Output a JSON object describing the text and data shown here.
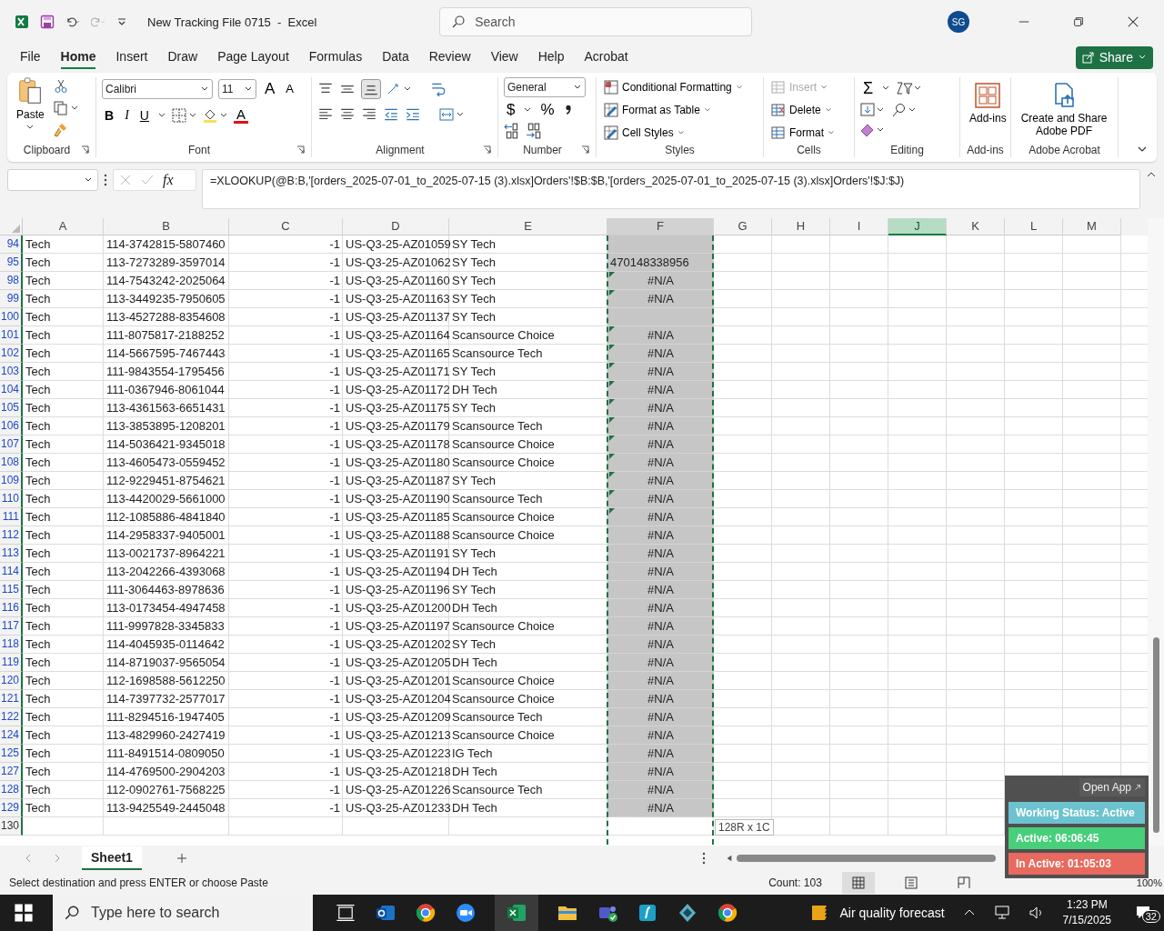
{
  "titlebar": {
    "title": "New Tracking File 0715  -  Excel",
    "search_placeholder": "Search",
    "avatar": "SG"
  },
  "menu_tabs": [
    {
      "label": "File",
      "selected": false
    },
    {
      "label": "Home",
      "selected": true
    },
    {
      "label": "Insert",
      "selected": false
    },
    {
      "label": "Draw",
      "selected": false
    },
    {
      "label": "Page Layout",
      "selected": false
    },
    {
      "label": "Formulas",
      "selected": false
    },
    {
      "label": "Data",
      "selected": false
    },
    {
      "label": "Review",
      "selected": false
    },
    {
      "label": "View",
      "selected": false
    },
    {
      "label": "Help",
      "selected": false
    },
    {
      "label": "Acrobat",
      "selected": false
    }
  ],
  "share_button": "Share",
  "ribbon": {
    "clipboard": {
      "paste": "Paste",
      "group": "Clipboard"
    },
    "font": {
      "name": "Calibri",
      "size": "11",
      "grow": "A",
      "shrink": "A",
      "bold": "B",
      "italic": "I",
      "underline": "U",
      "font_color": "A",
      "group": "Font"
    },
    "alignment": {
      "group": "Alignment"
    },
    "number": {
      "format": "General",
      "currency": "$",
      "percent": "%",
      "group": "Number"
    },
    "styles": {
      "items": [
        "Conditional Formatting",
        "Format as Table",
        "Cell Styles"
      ],
      "group": "Styles"
    },
    "cells": {
      "items": [
        {
          "label": "Insert",
          "disabled": true
        },
        {
          "label": "Delete",
          "disabled": false
        },
        {
          "label": "Format",
          "disabled": false
        }
      ],
      "group": "Cells"
    },
    "editing": {
      "sum": "Σ",
      "group": "Editing"
    },
    "addins": {
      "button": "Add-ins",
      "group": "Add-ins"
    },
    "acrobat": {
      "button": "Create and Share Adobe PDF",
      "group": "Adobe Acrobat"
    }
  },
  "formula_bar": {
    "fx": "fx",
    "formula": "=XLOOKUP(@B:B,'[orders_2025-07-01_to_2025-07-15 (3).xlsx]Orders'!$B:$B,'[orders_2025-07-01_to_2025-07-15 (3).xlsx]Orders'!$J:$J)"
  },
  "columns": [
    {
      "label": "A",
      "selected": false,
      "in_range": false
    },
    {
      "label": "B",
      "selected": false,
      "in_range": false
    },
    {
      "label": "C",
      "selected": false,
      "in_range": false
    },
    {
      "label": "D",
      "selected": false,
      "in_range": false
    },
    {
      "label": "E",
      "selected": false,
      "in_range": false
    },
    {
      "label": "F",
      "selected": false,
      "in_range": true
    },
    {
      "label": "G",
      "selected": false,
      "in_range": false
    },
    {
      "label": "H",
      "selected": false,
      "in_range": false
    },
    {
      "label": "I",
      "selected": false,
      "in_range": false
    },
    {
      "label": "J",
      "selected": true,
      "in_range": false
    },
    {
      "label": "K",
      "selected": false,
      "in_range": false
    },
    {
      "label": "L",
      "selected": false,
      "in_range": false
    },
    {
      "label": "M",
      "selected": false,
      "in_range": false
    }
  ],
  "rows": [
    {
      "num": "94",
      "cells": [
        "Tech",
        "114-3742815-5807460",
        "-1",
        "US-Q3-25-AZ01059",
        "SY Tech"
      ],
      "flagged": false
    },
    {
      "num": "95",
      "cells": [
        "Tech",
        "113-7273289-3597014",
        "-1",
        "US-Q3-25-AZ01062",
        "SY Tech"
      ],
      "f": "470148338956",
      "flagged": false
    },
    {
      "num": "98",
      "cells": [
        "Tech",
        "114-7543242-2025064",
        "-1",
        "US-Q3-25-AZ01160",
        "SY Tech"
      ],
      "f": "#N/A",
      "flagged": true
    },
    {
      "num": "99",
      "cells": [
        "Tech",
        "113-3449235-7950605",
        "-1",
        "US-Q3-25-AZ01163",
        "SY Tech"
      ],
      "f": "#N/A",
      "flagged": true
    },
    {
      "num": "100",
      "cells": [
        "Tech",
        "113-4527288-8354608",
        "-1",
        "US-Q3-25-AZ01137",
        "SY Tech"
      ],
      "flagged": false
    },
    {
      "num": "101",
      "cells": [
        "Tech",
        "111-8075817-2188252",
        "-1",
        "US-Q3-25-AZ01164",
        "Scansource Choice"
      ],
      "f": "#N/A",
      "flagged": true
    },
    {
      "num": "102",
      "cells": [
        "Tech",
        "114-5667595-7467443",
        "-1",
        "US-Q3-25-AZ01165",
        "Scansource Tech"
      ],
      "f": "#N/A",
      "flagged": true
    },
    {
      "num": "103",
      "cells": [
        "Tech",
        "111-9843554-1795456",
        "-1",
        "US-Q3-25-AZ01171",
        "SY Tech"
      ],
      "f": "#N/A",
      "flagged": true
    },
    {
      "num": "104",
      "cells": [
        "Tech",
        "111-0367946-8061044",
        "-1",
        "US-Q3-25-AZ01172",
        "DH Tech"
      ],
      "f": "#N/A",
      "flagged": true
    },
    {
      "num": "105",
      "cells": [
        "Tech",
        "113-4361563-6651431",
        "-1",
        "US-Q3-25-AZ01175",
        "SY Tech"
      ],
      "f": "#N/A",
      "flagged": true
    },
    {
      "num": "106",
      "cells": [
        "Tech",
        "113-3853895-1208201",
        "-1",
        "US-Q3-25-AZ01179",
        "Scansource Tech"
      ],
      "f": "#N/A",
      "flagged": true
    },
    {
      "num": "107",
      "cells": [
        "Tech",
        "114-5036421-9345018",
        "-1",
        "US-Q3-25-AZ01178",
        "Scansource Choice"
      ],
      "f": "#N/A",
      "flagged": true
    },
    {
      "num": "108",
      "cells": [
        "Tech",
        "113-4605473-0559452",
        "-1",
        "US-Q3-25-AZ01180",
        "Scansource Choice"
      ],
      "f": "#N/A",
      "flagged": true
    },
    {
      "num": "109",
      "cells": [
        "Tech",
        "112-9229451-8754621",
        "-1",
        "US-Q3-25-AZ01187",
        "SY Tech"
      ],
      "f": "#N/A",
      "flagged": true
    },
    {
      "num": "110",
      "cells": [
        "Tech",
        "113-4420029-5661000",
        "-1",
        "US-Q3-25-AZ01190",
        "Scansource Tech"
      ],
      "f": "#N/A",
      "flagged": true
    },
    {
      "num": "111",
      "cells": [
        "Tech",
        "112-1085886-4841840",
        "-1",
        "US-Q3-25-AZ01185",
        "Scansource Choice"
      ],
      "f": "#N/A",
      "flagged": true
    },
    {
      "num": "112",
      "cells": [
        "Tech",
        "114-2958337-9405001",
        "-1",
        "US-Q3-25-AZ01188",
        "Scansource Choice"
      ],
      "f": "#N/A",
      "flagged": false
    },
    {
      "num": "113",
      "cells": [
        "Tech",
        "113-0021737-8964221",
        "-1",
        "US-Q3-25-AZ01191",
        "SY Tech"
      ],
      "f": "#N/A",
      "flagged": false
    },
    {
      "num": "114",
      "cells": [
        "Tech",
        "113-2042266-4393068",
        "-1",
        "US-Q3-25-AZ01194",
        "DH Tech"
      ],
      "f": "#N/A",
      "flagged": false
    },
    {
      "num": "115",
      "cells": [
        "Tech",
        "111-3064463-8978636",
        "-1",
        "US-Q3-25-AZ01196",
        "SY Tech"
      ],
      "f": "#N/A",
      "flagged": false
    },
    {
      "num": "116",
      "cells": [
        "Tech",
        "113-0173454-4947458",
        "-1",
        "US-Q3-25-AZ01200",
        "DH Tech"
      ],
      "f": "#N/A",
      "flagged": false
    },
    {
      "num": "117",
      "cells": [
        "Tech",
        "111-9997828-3345833",
        "-1",
        "US-Q3-25-AZ01197",
        "Scansource Choice"
      ],
      "f": "#N/A",
      "flagged": false
    },
    {
      "num": "118",
      "cells": [
        "Tech",
        "114-4045935-0114642",
        "-1",
        "US-Q3-25-AZ01202",
        "SY Tech"
      ],
      "f": "#N/A",
      "flagged": false
    },
    {
      "num": "119",
      "cells": [
        "Tech",
        "114-8719037-9565054",
        "-1",
        "US-Q3-25-AZ01205",
        "DH Tech"
      ],
      "f": "#N/A",
      "flagged": false
    },
    {
      "num": "120",
      "cells": [
        "Tech",
        "112-1698588-5612250",
        "-1",
        "US-Q3-25-AZ01201",
        "Scansource Choice"
      ],
      "f": "#N/A",
      "flagged": false
    },
    {
      "num": "121",
      "cells": [
        "Tech",
        "114-7397732-2577017",
        "-1",
        "US-Q3-25-AZ01204",
        "Scansource Choice"
      ],
      "f": "#N/A",
      "flagged": false
    },
    {
      "num": "122",
      "cells": [
        "Tech",
        "111-8294516-1947405",
        "-1",
        "US-Q3-25-AZ01209",
        "Scansource Tech"
      ],
      "f": "#N/A",
      "flagged": false
    },
    {
      "num": "124",
      "cells": [
        "Tech",
        "113-4829960-2427419",
        "-1",
        "US-Q3-25-AZ01213",
        "Scansource Choice"
      ],
      "f": "#N/A",
      "flagged": false
    },
    {
      "num": "125",
      "cells": [
        "Tech",
        "111-8491514-0809050",
        "-1",
        "US-Q3-25-AZ01223",
        "IG Tech"
      ],
      "f": "#N/A",
      "flagged": false
    },
    {
      "num": "127",
      "cells": [
        "Tech",
        "114-4769500-2904203",
        "-1",
        "US-Q3-25-AZ01218",
        "DH Tech"
      ],
      "f": "#N/A",
      "flagged": false
    },
    {
      "num": "128",
      "cells": [
        "Tech",
        "112-0902761-7568225",
        "-1",
        "US-Q3-25-AZ01226",
        "Scansource Tech"
      ],
      "f": "#N/A",
      "flagged": false
    },
    {
      "num": "129",
      "cells": [
        "Tech",
        "113-9425549-2445048",
        "-1",
        "US-Q3-25-AZ01233",
        "DH Tech"
      ],
      "f": "#N/A",
      "flagged": false
    }
  ],
  "empty_rows": [
    "130"
  ],
  "selection_tooltip": "128R x 1C",
  "sheet_tabs": [
    {
      "label": "Sheet1",
      "selected": true
    }
  ],
  "status_bar": {
    "message": "Select destination and press ENTER or choose Paste",
    "count": "Count: 103",
    "zoom": "100%"
  },
  "tracker_widget": {
    "open_app": "Open App",
    "lines": [
      {
        "text": "Working Status: Active",
        "color": "#6cc3cf"
      },
      {
        "text": "Active: 06:06:45",
        "color": "#47cf7a"
      },
      {
        "text": "In Active: 01:05:03",
        "color": "#e86a5e"
      }
    ]
  },
  "taskbar": {
    "search_placeholder": "Type here to search",
    "weather": "Air quality forecast",
    "time": "1:23 PM",
    "date": "7/15/2025",
    "notifications": "32"
  }
}
